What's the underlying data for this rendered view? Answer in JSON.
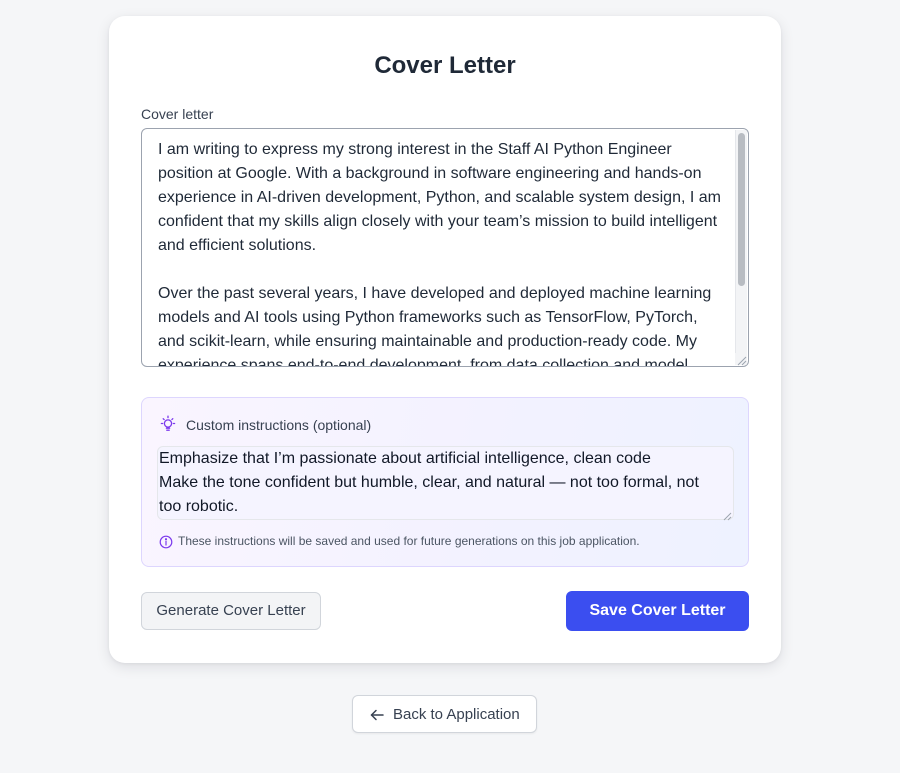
{
  "page": {
    "title": "Cover Letter"
  },
  "cover_letter": {
    "label": "Cover letter",
    "value": "I am writing to express my strong interest in the Staff AI Python Engineer position at Google. With a background in software engineering and hands-on experience in AI-driven development, Python, and scalable system design, I am confident that my skills align closely with your team’s mission to build intelligent and efficient solutions.\n\nOver the past several years, I have developed and deployed machine learning models and AI tools using Python frameworks such as TensorFlow, PyTorch, and scikit-learn, while ensuring maintainable and production-ready code. My experience spans end-to-end development, from data collection and model"
  },
  "custom_instructions": {
    "label": "Custom instructions (optional)",
    "value": "Emphasize that I’m passionate about artificial intelligence, clean code\nMake the tone confident but humble, clear, and natural — not too formal, not too robotic.",
    "note": "These instructions will be saved and used for future generations on this job application.",
    "icon": "lightbulb-icon"
  },
  "actions": {
    "generate_label": "Generate Cover Letter",
    "save_label": "Save Cover Letter",
    "back_label": "Back to Application"
  },
  "colors": {
    "primary": "#3b4ef0",
    "accent_purple": "#7c3aed",
    "background": "#f5f6f8"
  }
}
